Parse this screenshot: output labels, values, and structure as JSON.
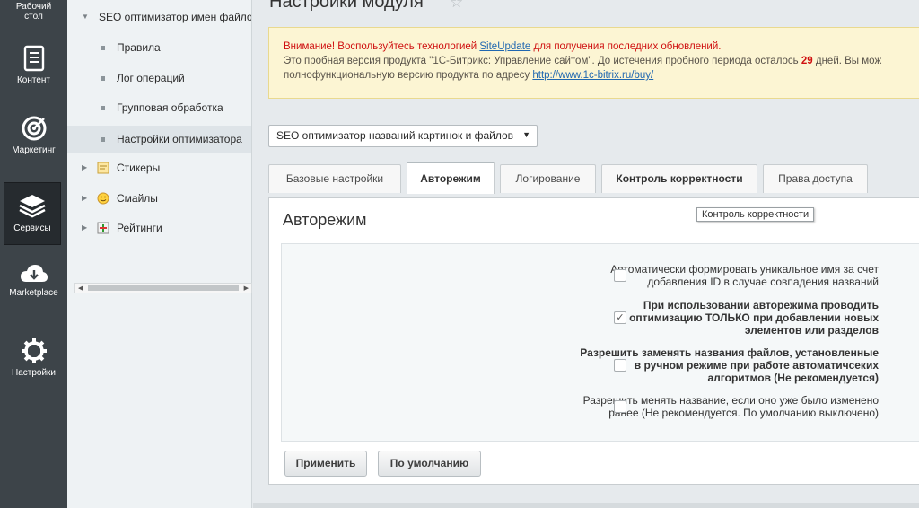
{
  "rail": {
    "items": [
      {
        "label": "Рабочий стол",
        "icon": "desktop-icon"
      },
      {
        "label": "Контент",
        "icon": "document-icon"
      },
      {
        "label": "Маркетинг",
        "icon": "target-icon"
      },
      {
        "label": "Сервисы",
        "icon": "layers-icon"
      },
      {
        "label": "Marketplace",
        "icon": "cloud-download-icon"
      },
      {
        "label": "Настройки",
        "icon": "gear-icon"
      }
    ],
    "active": "Сервисы"
  },
  "tree": {
    "items": [
      {
        "label": "SEO оптимизатор имен файлов",
        "kind": "parent-expanded"
      },
      {
        "label": "Правила",
        "kind": "child"
      },
      {
        "label": "Лог операций",
        "kind": "child"
      },
      {
        "label": "Групповая обработка",
        "kind": "child"
      },
      {
        "label": "Настройки оптимизатора",
        "kind": "child",
        "active": true
      },
      {
        "label": "Стикеры",
        "kind": "parent-collapsed",
        "icon": "sticker-icon"
      },
      {
        "label": "Смайлы",
        "kind": "parent-collapsed",
        "icon": "smiley-icon"
      },
      {
        "label": "Рейтинги",
        "kind": "parent-collapsed",
        "icon": "rating-icon"
      }
    ]
  },
  "main": {
    "title": "Настройки модуля",
    "notice": {
      "warning_prefix": "Внимание! Воспользуйтесь технологией ",
      "link_text": "SiteUpdate",
      "warning_suffix": " для получения последних обновлений.",
      "line2_prefix": "Это пробная версия продукта \"1С-Битрикс: Управление сайтом\". До истечения пробного периода осталось ",
      "days": "29",
      "line2_suffix": " дней. Вы мож",
      "line3_prefix": "полнофункциональную версию продукта по адресу ",
      "url": "http://www.1c-bitrix.ru/buy/"
    },
    "module_select": {
      "value": "SEO оптимизатор названий картинок и файлов"
    },
    "tabs": [
      {
        "label": "Базовые настройки"
      },
      {
        "label": "Авторежим",
        "active": true
      },
      {
        "label": "Логирование"
      },
      {
        "label": "Контроль корректности"
      },
      {
        "label": "Права доступа"
      }
    ],
    "tooltip": "Контроль корректности",
    "panel_title": "Авторежим",
    "options": [
      {
        "label": "Автоматически формировать уникальное имя за счет добавления ID в случае совпадения названий",
        "checked": false
      },
      {
        "label": "При использовании авторежима проводить оптимизацию ТОЛЬКО при добавлении новых элементов или разделов",
        "checked": true
      },
      {
        "label": "Разрешить заменять названия файлов, установленные в ручном режиме при работе автоматичсеких алгоритмов (Не рекомендуется)",
        "checked": false
      },
      {
        "label": "Разрешить менять название, если оно уже было изменено ранее (Не рекомендуется. По умолчанию выключено)",
        "checked": false
      }
    ],
    "buttons": {
      "apply": "Применить",
      "default": "По умолчанию"
    }
  },
  "colors": {
    "rail_bg": "#3d4449",
    "notice_bg": "#fcf5d3",
    "warning_red": "#cf1010",
    "link_blue": "#2067b0"
  }
}
